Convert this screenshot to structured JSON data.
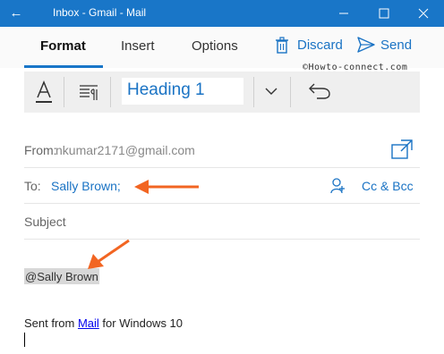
{
  "window": {
    "title": "Inbox - Gmail - Mail",
    "accent_color": "#1976c8"
  },
  "ribbon": {
    "tabs": [
      {
        "label": "Format",
        "selected": true
      },
      {
        "label": "Insert",
        "selected": false
      },
      {
        "label": "Options",
        "selected": false
      }
    ],
    "discard_label": "Discard",
    "send_label": "Send",
    "watermark": "©Howto-connect.com"
  },
  "toolbar": {
    "style_value": "Heading 1",
    "icons": [
      "font-format-icon",
      "paragraph-icon",
      "chevron-down-icon",
      "undo-icon"
    ]
  },
  "fields": {
    "from_label": "From:",
    "from_value": "nkumar2171@gmail.com",
    "to_label": "To:",
    "to_value": "Sally Brown;",
    "cc_bcc_label": "Cc & Bcc",
    "subject_placeholder": "Subject"
  },
  "body": {
    "mention": "@Sally Brown",
    "signature_prefix": "Sent from ",
    "signature_link": "Mail",
    "signature_suffix": " for Windows 10"
  },
  "annotations": {
    "arrow_color": "#f26522"
  }
}
